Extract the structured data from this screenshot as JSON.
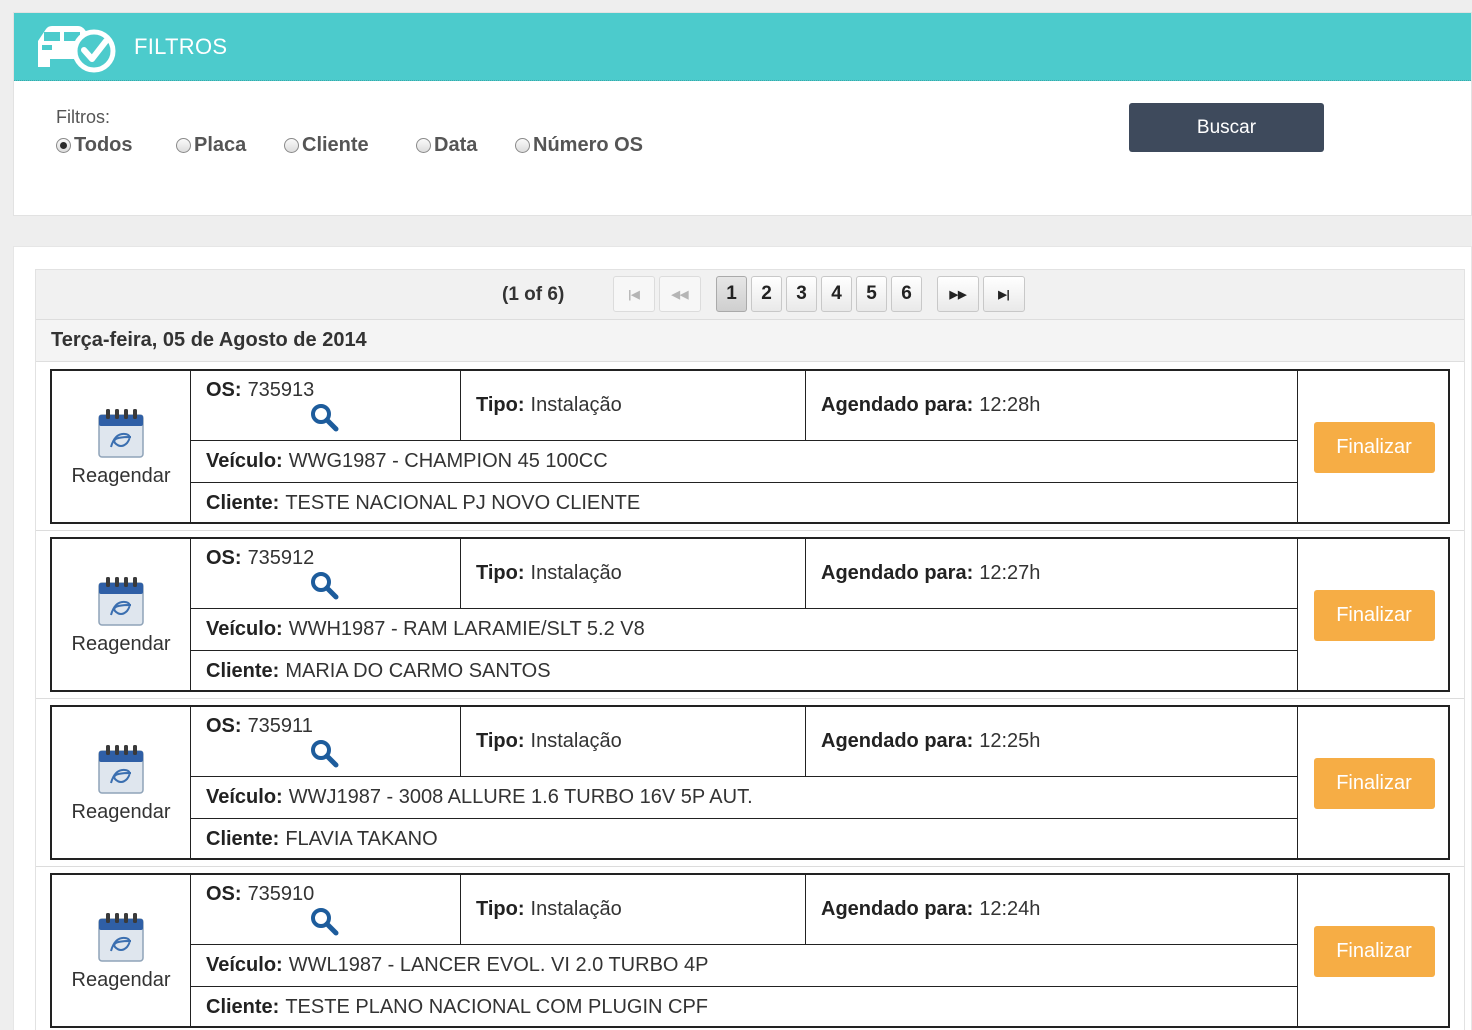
{
  "header": {
    "title": "FILTROS"
  },
  "filters": {
    "label": "Filtros:",
    "options": [
      {
        "label": "Todos",
        "checked": true
      },
      {
        "label": "Placa",
        "checked": false
      },
      {
        "label": "Cliente",
        "checked": false
      },
      {
        "label": "Data",
        "checked": false
      },
      {
        "label": "Número OS",
        "checked": false
      }
    ],
    "search_label": "Buscar"
  },
  "paginator": {
    "report": "(1 of 6)",
    "first": "|◀",
    "prev": "◀◀",
    "pages": [
      "1",
      "2",
      "3",
      "4",
      "5",
      "6"
    ],
    "current": "1",
    "next": "▶▶",
    "last": "▶|"
  },
  "date_header": "Terça-feira, 05 de Agosto de 2014",
  "labels": {
    "os": "OS:",
    "type": "Tipo:",
    "scheduled": "Agendado para:",
    "vehicle": "Veículo:",
    "client": "Cliente:",
    "reschedule": "Reagendar",
    "finalize": "Finalizar"
  },
  "records": [
    {
      "os": "735913",
      "type": "Instalação",
      "scheduled": "12:28h",
      "vehicle": "WWG1987 - CHAMPION 45 100CC",
      "client": "TESTE NACIONAL PJ NOVO CLIENTE"
    },
    {
      "os": "735912",
      "type": "Instalação",
      "scheduled": "12:27h",
      "vehicle": "WWH1987 - RAM LARAMIE/SLT 5.2 V8",
      "client": "MARIA DO CARMO SANTOS"
    },
    {
      "os": "735911",
      "type": "Instalação",
      "scheduled": "12:25h",
      "vehicle": "WWJ1987 - 3008 ALLURE 1.6 TURBO 16V 5P AUT.",
      "client": "FLAVIA TAKANO"
    },
    {
      "os": "735910",
      "type": "Instalação",
      "scheduled": "12:24h",
      "vehicle": "WWL1987 - LANCER EVOL. VI 2.0 TURBO 4P",
      "client": "TESTE PLANO NACIONAL COM PLUGIN CPF"
    }
  ],
  "colors": {
    "header": "#4ccbcc",
    "search_button": "#3e4a5c",
    "finalize_button": "#f6ad45",
    "search_icon": "#1d5c9c"
  }
}
